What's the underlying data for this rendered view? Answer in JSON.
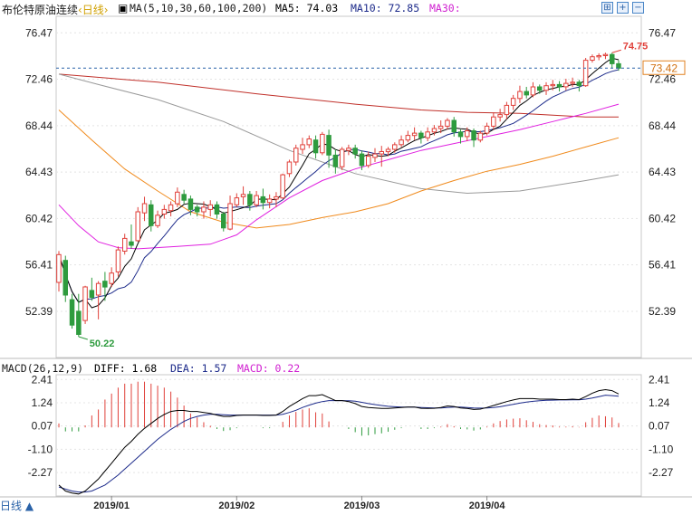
{
  "header": {
    "instrument": "布伦特原油连续",
    "period": "‹日线›",
    "ma_params": "MA(5,10,30,60,100,200)",
    "ma5_label": "MA5: 74.03",
    "ma10_label": "MA10: 72.85",
    "ma30_label": "MA30:",
    "toolbar_icons": [
      "chart-toggle-icon",
      "plus-icon",
      "minus-icon"
    ]
  },
  "macd_header": {
    "params": "MACD(26,12,9)",
    "diff_label": "DIFF: 1.68",
    "dea_label": "DEA: 1.57",
    "macd_label": "MACD: 0.22"
  },
  "period_button": "日线 ▲",
  "colors": {
    "up": "#e0403a",
    "down": "#2e9b3e",
    "ma5": "#000000",
    "ma10": "#1c2a8a",
    "ma30": "#e020e0",
    "ma60": "#f08a1c",
    "ma100": "#9a9a9a",
    "ma200": "#c0302a",
    "diff": "#000000",
    "dea": "#1c2a8a",
    "title": "#1a1a9a",
    "magenta": "#d020d0"
  },
  "chart_data": {
    "type": "candlestick",
    "price_axis": {
      "ticks": [
        "76.47",
        "72.46",
        "68.44",
        "64.43",
        "60.42",
        "56.41",
        "52.39"
      ],
      "ylim": [
        48.4,
        77.9
      ]
    },
    "annotations": {
      "high": "74.75",
      "low": "50.22",
      "last": "73.42"
    },
    "x_ticks": [
      "2019/01",
      "2019/02",
      "2019/03",
      "2019/04"
    ],
    "x_tick_index": [
      8,
      27,
      46,
      65
    ],
    "candles": [
      [
        54.9,
        57.3,
        54.1,
        57.6
      ],
      [
        56.8,
        53.8,
        53.2,
        57.2
      ],
      [
        53.4,
        51.2,
        50.9,
        53.9
      ],
      [
        52.4,
        50.4,
        50.2,
        53.9
      ],
      [
        51.6,
        54.5,
        51.3,
        54.6
      ],
      [
        54.2,
        53.6,
        53.3,
        55.3
      ],
      [
        53.8,
        54.8,
        51.7,
        55.0
      ],
      [
        55.0,
        54.5,
        53.3,
        55.8
      ],
      [
        54.8,
        55.7,
        54.5,
        56.2
      ],
      [
        55.8,
        57.7,
        55.4,
        58.0
      ],
      [
        57.6,
        58.7,
        57.3,
        59.1
      ],
      [
        58.4,
        58.1,
        57.8,
        59.9
      ],
      [
        58.5,
        61.0,
        58.4,
        61.4
      ],
      [
        60.9,
        61.7,
        60.2,
        62.3
      ],
      [
        61.6,
        59.8,
        59.3,
        62.0
      ],
      [
        59.8,
        60.7,
        59.6,
        61.1
      ],
      [
        60.8,
        61.2,
        60.4,
        61.6
      ],
      [
        61.1,
        61.6,
        60.6,
        61.9
      ],
      [
        61.7,
        62.7,
        61.4,
        63.1
      ],
      [
        62.5,
        62.0,
        61.7,
        62.9
      ],
      [
        62.1,
        61.2,
        60.7,
        62.4
      ],
      [
        61.4,
        61.0,
        60.6,
        61.6
      ],
      [
        61.0,
        61.4,
        60.4,
        61.9
      ],
      [
        61.2,
        61.6,
        60.6,
        62.0
      ],
      [
        61.6,
        60.8,
        60.4,
        61.9
      ],
      [
        60.8,
        59.6,
        59.3,
        61.0
      ],
      [
        59.5,
        61.7,
        59.4,
        62.4
      ],
      [
        61.6,
        62.2,
        61.4,
        62.6
      ],
      [
        62.3,
        62.5,
        61.6,
        63.2
      ],
      [
        62.5,
        61.6,
        61.1,
        62.8
      ],
      [
        61.6,
        62.4,
        61.4,
        62.8
      ],
      [
        62.3,
        61.8,
        61.2,
        63.0
      ],
      [
        61.8,
        62.1,
        61.3,
        62.5
      ],
      [
        62.1,
        62.3,
        61.4,
        62.7
      ],
      [
        62.2,
        64.2,
        62.1,
        64.3
      ],
      [
        64.3,
        65.3,
        64.0,
        65.5
      ],
      [
        65.3,
        66.5,
        65.0,
        66.8
      ],
      [
        66.4,
        66.8,
        66.0,
        67.4
      ],
      [
        66.8,
        67.3,
        66.5,
        67.6
      ],
      [
        67.2,
        66.1,
        65.6,
        67.6
      ],
      [
        66.1,
        67.7,
        65.9,
        67.9
      ],
      [
        67.6,
        65.9,
        64.8,
        68.1
      ],
      [
        65.9,
        64.9,
        64.3,
        66.4
      ],
      [
        64.9,
        66.4,
        64.6,
        66.6
      ],
      [
        66.3,
        66.5,
        65.9,
        66.8
      ],
      [
        66.5,
        66.0,
        65.6,
        66.8
      ],
      [
        66.0,
        65.0,
        64.6,
        66.3
      ],
      [
        65.0,
        65.8,
        64.8,
        66.2
      ],
      [
        65.7,
        66.0,
        65.3,
        66.5
      ],
      [
        66.0,
        66.2,
        64.9,
        66.7
      ],
      [
        66.2,
        66.4,
        65.8,
        66.6
      ],
      [
        66.4,
        66.8,
        66.1,
        67.0
      ],
      [
        66.8,
        67.2,
        66.6,
        67.6
      ],
      [
        67.2,
        67.6,
        67.0,
        68.0
      ],
      [
        67.6,
        67.8,
        67.2,
        68.3
      ],
      [
        67.8,
        67.4,
        66.9,
        68.0
      ],
      [
        67.4,
        67.9,
        67.1,
        68.3
      ],
      [
        67.9,
        68.2,
        67.6,
        68.5
      ],
      [
        68.2,
        68.4,
        67.8,
        68.9
      ],
      [
        68.4,
        68.9,
        68.1,
        69.1
      ],
      [
        68.9,
        67.9,
        67.5,
        69.2
      ],
      [
        67.9,
        67.5,
        66.9,
        68.1
      ],
      [
        67.5,
        68.0,
        67.1,
        68.3
      ],
      [
        68.0,
        67.2,
        66.6,
        68.2
      ],
      [
        67.2,
        67.8,
        67.0,
        68.0
      ],
      [
        67.8,
        68.4,
        67.6,
        68.7
      ],
      [
        68.4,
        69.2,
        68.1,
        69.6
      ],
      [
        69.2,
        69.4,
        68.8,
        69.9
      ],
      [
        69.4,
        70.2,
        69.0,
        70.5
      ],
      [
        70.2,
        70.8,
        69.8,
        71.1
      ],
      [
        70.8,
        71.4,
        70.4,
        71.9
      ],
      [
        71.4,
        71.1,
        70.8,
        71.8
      ],
      [
        71.1,
        71.8,
        70.9,
        72.2
      ],
      [
        71.8,
        71.5,
        71.2,
        72.0
      ],
      [
        71.5,
        71.9,
        71.1,
        72.2
      ],
      [
        71.9,
        72.0,
        71.5,
        72.4
      ],
      [
        72.0,
        71.8,
        71.4,
        72.3
      ],
      [
        71.8,
        72.1,
        71.5,
        72.5
      ],
      [
        72.1,
        72.2,
        71.8,
        72.6
      ],
      [
        72.2,
        71.9,
        71.4,
        72.4
      ],
      [
        71.9,
        74.1,
        71.8,
        74.3
      ],
      [
        74.1,
        74.4,
        73.9,
        74.6
      ],
      [
        74.4,
        74.5,
        74.1,
        74.7
      ],
      [
        74.5,
        74.6,
        74.2,
        74.75
      ],
      [
        74.6,
        73.8,
        73.4,
        74.75
      ],
      [
        73.8,
        73.42,
        73.2,
        74.1
      ]
    ],
    "ma5_end": 74.03,
    "ma10_end": 72.85,
    "ma_lines": {
      "ma100": [
        [
          0,
          72.9
        ],
        [
          6,
          72.0
        ],
        [
          15,
          70.7
        ],
        [
          25,
          68.8
        ],
        [
          35,
          66.3
        ],
        [
          45,
          64.3
        ],
        [
          55,
          63.0
        ],
        [
          62,
          62.6
        ],
        [
          70,
          62.8
        ],
        [
          80,
          63.7
        ],
        [
          85,
          64.2
        ]
      ],
      "ma200": [
        [
          0,
          72.9
        ],
        [
          15,
          72.2
        ],
        [
          30,
          71.2
        ],
        [
          45,
          70.3
        ],
        [
          55,
          69.8
        ],
        [
          62,
          69.6
        ],
        [
          70,
          69.5
        ],
        [
          80,
          69.2
        ],
        [
          85,
          69.2
        ]
      ],
      "ma60": [
        [
          0,
          69.8
        ],
        [
          5,
          67.2
        ],
        [
          10,
          64.7
        ],
        [
          15,
          62.8
        ],
        [
          20,
          61.0
        ],
        [
          25,
          60.1
        ],
        [
          30,
          59.6
        ],
        [
          35,
          59.9
        ],
        [
          40,
          60.5
        ],
        [
          45,
          61.0
        ],
        [
          50,
          61.7
        ],
        [
          55,
          62.8
        ],
        [
          60,
          63.7
        ],
        [
          65,
          64.5
        ],
        [
          70,
          65.1
        ],
        [
          75,
          65.8
        ],
        [
          80,
          66.6
        ],
        [
          85,
          67.4
        ]
      ],
      "ma30": [
        [
          0,
          61.6
        ],
        [
          3,
          59.8
        ],
        [
          6,
          58.4
        ],
        [
          9,
          57.9
        ],
        [
          12,
          57.8
        ],
        [
          18,
          58.0
        ],
        [
          23,
          58.2
        ],
        [
          27,
          59.0
        ],
        [
          30,
          60.3
        ],
        [
          35,
          62.2
        ],
        [
          40,
          63.7
        ],
        [
          45,
          64.7
        ],
        [
          50,
          65.5
        ],
        [
          55,
          66.3
        ],
        [
          60,
          66.9
        ],
        [
          65,
          67.5
        ],
        [
          70,
          68.1
        ],
        [
          75,
          68.8
        ],
        [
          80,
          69.5
        ],
        [
          85,
          70.3
        ]
      ]
    },
    "macd_axis": {
      "ticks": [
        "2.41",
        "1.24",
        "0.07",
        "-1.10",
        "-2.27"
      ],
      "ylim": [
        -3.45,
        2.65
      ]
    },
    "diff": [
      -2.9,
      -3.2,
      -3.3,
      -3.35,
      -3.2,
      -2.9,
      -2.6,
      -2.2,
      -1.8,
      -1.4,
      -1.0,
      -0.7,
      -0.35,
      -0.05,
      0.2,
      0.45,
      0.65,
      0.8,
      0.85,
      0.85,
      0.8,
      0.8,
      0.75,
      0.7,
      0.62,
      0.55,
      0.55,
      0.6,
      0.62,
      0.62,
      0.62,
      0.6,
      0.6,
      0.62,
      0.8,
      1.05,
      1.25,
      1.45,
      1.6,
      1.6,
      1.65,
      1.5,
      1.35,
      1.35,
      1.3,
      1.2,
      1.05,
      1.0,
      0.98,
      0.95,
      0.95,
      0.98,
      1.0,
      1.02,
      1.02,
      0.96,
      0.95,
      0.96,
      1.0,
      1.08,
      1.05,
      0.98,
      0.95,
      0.9,
      0.92,
      1.0,
      1.1,
      1.2,
      1.3,
      1.38,
      1.45,
      1.45,
      1.45,
      1.42,
      1.42,
      1.42,
      1.4,
      1.4,
      1.42,
      1.4,
      1.55,
      1.72,
      1.85,
      1.9,
      1.85,
      1.68
    ],
    "dea": [
      -3.0,
      -3.1,
      -3.2,
      -3.25,
      -3.25,
      -3.2,
      -3.05,
      -2.9,
      -2.65,
      -2.4,
      -2.1,
      -1.8,
      -1.5,
      -1.2,
      -0.9,
      -0.6,
      -0.35,
      -0.1,
      0.1,
      0.3,
      0.45,
      0.55,
      0.62,
      0.66,
      0.66,
      0.64,
      0.62,
      0.62,
      0.62,
      0.62,
      0.62,
      0.62,
      0.62,
      0.62,
      0.66,
      0.75,
      0.86,
      1.0,
      1.12,
      1.22,
      1.3,
      1.35,
      1.35,
      1.35,
      1.34,
      1.32,
      1.26,
      1.2,
      1.15,
      1.1,
      1.06,
      1.04,
      1.02,
      1.02,
      1.02,
      1.0,
      0.99,
      0.98,
      0.98,
      1.0,
      1.02,
      1.02,
      1.0,
      0.98,
      0.97,
      0.98,
      1.0,
      1.04,
      1.1,
      1.16,
      1.22,
      1.27,
      1.31,
      1.34,
      1.36,
      1.37,
      1.38,
      1.38,
      1.39,
      1.39,
      1.42,
      1.48,
      1.55,
      1.62,
      1.6,
      1.57
    ]
  }
}
